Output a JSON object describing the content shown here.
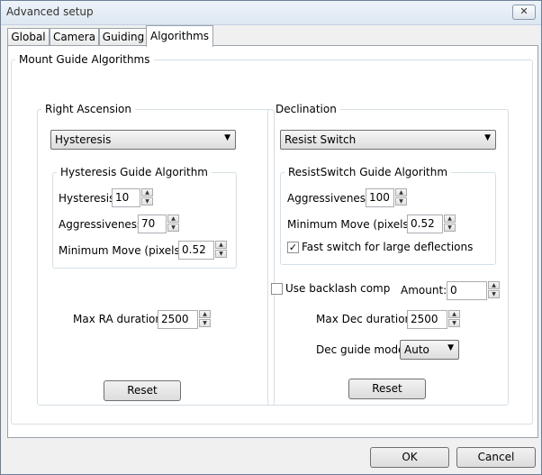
{
  "window": {
    "title": "Advanced setup",
    "close_glyph": "✕"
  },
  "tabs": [
    {
      "label": "Global",
      "active": false
    },
    {
      "label": "Camera",
      "active": false
    },
    {
      "label": "Guiding",
      "active": false
    },
    {
      "label": "Algorithms",
      "active": true
    }
  ],
  "mount_group": "Mount Guide Algorithms",
  "ra": {
    "group": "Right Ascension",
    "algorithm": "Hysteresis",
    "algo_group": "Hysteresis Guide Algorithm",
    "hysteresis_label": "Hysteresis:",
    "hysteresis_value": "10",
    "aggressiveness_label": "Aggressiveness:",
    "aggressiveness_value": "70",
    "min_move_label": "Minimum Move (pixels):",
    "min_move_value": "0.52",
    "max_duration_label": "Max RA duration:",
    "max_duration_value": "2500",
    "reset_label": "Reset"
  },
  "dec": {
    "group": "Declination",
    "algorithm": "Resist Switch",
    "algo_group": "ResistSwitch Guide Algorithm",
    "aggressiveness_label": "Aggressiveness:",
    "aggressiveness_value": "100",
    "min_move_label": "Minimum Move (pixels):",
    "min_move_value": "0.52",
    "fast_switch_label": "Fast switch for large deflections",
    "fast_switch_checked": true,
    "backlash_label": "Use backlash comp",
    "backlash_checked": false,
    "amount_label": "Amount:",
    "amount_value": "0",
    "max_duration_label": "Max Dec duration:",
    "max_duration_value": "2500",
    "guide_mode_label": "Dec guide mode:",
    "guide_mode_value": "Auto",
    "reset_label": "Reset"
  },
  "footer": {
    "ok_label": "OK",
    "cancel_label": "Cancel"
  },
  "icons": {
    "dropdown": "chevron-down-icon",
    "spin_up": "spin-up-icon",
    "spin_down": "spin-down-icon",
    "check": "checkmark-icon"
  },
  "glyphs": {
    "arrow": "▼",
    "up": "▲",
    "down": "▼",
    "check": "✓"
  }
}
